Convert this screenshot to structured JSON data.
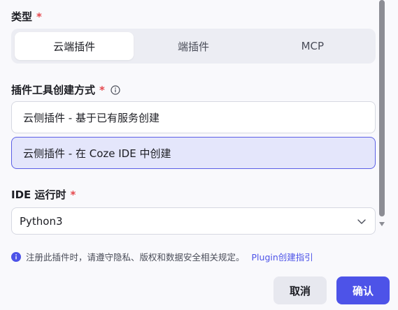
{
  "type_field": {
    "label": "类型",
    "required_mark": "*",
    "options": [
      "云端插件",
      "端插件",
      "MCP"
    ],
    "selected": "云端插件"
  },
  "creation_method": {
    "label": "插件工具创建方式",
    "required_mark": "*",
    "info_icon": "info-circle-icon",
    "options": [
      "云侧插件 - 基于已有服务创建",
      "云侧插件 - 在 Coze IDE 中创建"
    ],
    "selected": "云侧插件 - 在 Coze IDE 中创建"
  },
  "ide_runtime": {
    "label": "IDE 运行时",
    "required_mark": "*",
    "value": "Python3"
  },
  "notice": {
    "text": "注册此插件时，请遵守隐私、版权和数据安全相关规定。",
    "link": "Plugin创建指引"
  },
  "buttons": {
    "cancel": "取消",
    "confirm": "确认"
  },
  "colors": {
    "accent": "#4d53e8",
    "required": "#e5484d",
    "selected_bg": "#e4e6fb"
  }
}
